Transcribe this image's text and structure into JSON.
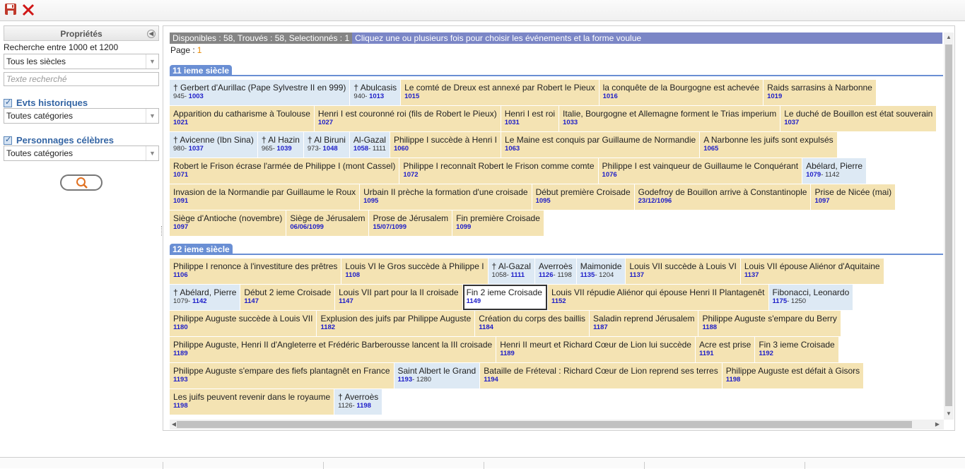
{
  "toolbar": {
    "save": "save-icon",
    "close": "close-icon"
  },
  "sidebar": {
    "title": "Propriétés",
    "range_label": "Recherche entre 1000 et 1200",
    "siecle_select": "Tous les siècles",
    "search_placeholder": "Texte recherché",
    "evts_label": "Evts historiques",
    "evts_select": "Toutes catégories",
    "pers_label": "Personnages célèbres",
    "pers_select": "Toutes catégories"
  },
  "status": {
    "counts": "Disponibles : 58, Trouvés : 58, Selectionnés : 1",
    "hint": "Cliquez une ou plusieurs fois pour choisir les événements et la forme voulue"
  },
  "page": {
    "label": "Page :",
    "number": "1"
  },
  "sections": [
    {
      "title": "11 ieme siècle",
      "rows": [
        [
          {
            "kind": "pe",
            "t": "† Gerbert d'Aurillac (Pape Sylvestre II en 999)",
            "y0": "945- ",
            "y": "1003"
          },
          {
            "kind": "pe",
            "t": "† Abulcasis",
            "y0": "940- ",
            "y": "1013"
          },
          {
            "kind": "ev",
            "t": "Le comté de Dreux est annexé par Robert le Pieux",
            "y": "1015"
          },
          {
            "kind": "ev",
            "t": "la conquête de la Bourgogne est achevée",
            "y": "1016"
          },
          {
            "kind": "ev",
            "t": "Raids sarrasins à Narbonne",
            "y": "1019"
          }
        ],
        [
          {
            "kind": "ev",
            "t": "Apparition du catharisme à Toulouse",
            "y": "1021"
          },
          {
            "kind": "ev",
            "t": "Henri I est couronné roi (fils de Robert le Pieux)",
            "y": "1027"
          },
          {
            "kind": "ev",
            "t": "Henri I est roi",
            "y": "1031"
          },
          {
            "kind": "ev",
            "t": "Italie, Bourgogne et Allemagne forment le Trias imperium",
            "y": "1033"
          },
          {
            "kind": "ev",
            "t": "Le duché de Bouillon est état souverain",
            "y": "1037"
          }
        ],
        [
          {
            "kind": "pe",
            "t": "† Avicenne (Ibn Sina)",
            "y0": "980- ",
            "y": "1037"
          },
          {
            "kind": "pe",
            "t": "† Al Hazin",
            "y0": "965- ",
            "y": "1039"
          },
          {
            "kind": "pe",
            "t": "† Al Biruni",
            "y0": "973- ",
            "y": "1048"
          },
          {
            "kind": "pe",
            "t": "Al-Gazal",
            "y": "1058",
            "y1": "- 1111"
          },
          {
            "kind": "ev",
            "t": "Philippe I succède à Henri I",
            "y": "1060"
          },
          {
            "kind": "ev",
            "t": "Le Maine est conquis par Guillaume de Normandie",
            "y": "1063"
          },
          {
            "kind": "ev",
            "t": "A Narbonne les juifs sont expulsés",
            "y": "1065"
          }
        ],
        [
          {
            "kind": "ev",
            "t": "Robert le Frison écrase l'armée de Philippe I (mont Cassel)",
            "y": "1071"
          },
          {
            "kind": "ev",
            "t": "Philippe I reconnaît Robert le Frison comme comte",
            "y": "1072"
          },
          {
            "kind": "ev",
            "t": "Philippe I est vainqueur de Guillaume le Conquérant",
            "y": "1076"
          },
          {
            "kind": "pe",
            "t": "Abélard, Pierre",
            "y": "1079",
            "y1": "- 1142"
          }
        ],
        [
          {
            "kind": "ev",
            "t": "Invasion de la Normandie par Guillaume le Roux",
            "y": "1091"
          },
          {
            "kind": "ev",
            "t": "Urbain II prèche la formation d'une croisade",
            "y": "1095"
          },
          {
            "kind": "ev",
            "t": "Début première Croisade",
            "y": "1095"
          },
          {
            "kind": "ev",
            "t": "Godefroy de Bouillon arrive à Constantinople",
            "y": "23/12/1096"
          },
          {
            "kind": "ev",
            "t": "Prise de Nicée (mai)",
            "y": "1097"
          }
        ],
        [
          {
            "kind": "ev",
            "t": "Siège d'Antioche (novembre)",
            "y": "1097"
          },
          {
            "kind": "ev",
            "t": "Siège de Jérusalem",
            "y": "06/06/1099"
          },
          {
            "kind": "ev",
            "t": "Prose de Jérusalem",
            "y": "15/07/1099"
          },
          {
            "kind": "ev",
            "t": "Fin première Croisade",
            "y": "1099"
          }
        ]
      ]
    },
    {
      "title": "12 ieme siècle",
      "rows": [
        [
          {
            "kind": "ev",
            "t": "Philippe I renonce à l'investiture des prêtres",
            "y": "1106"
          },
          {
            "kind": "ev",
            "t": "Louis VI le Gros succède à Philippe I",
            "y": "1108"
          },
          {
            "kind": "pe",
            "t": "† Al-Gazal",
            "y0": "1058- ",
            "y": "1111"
          },
          {
            "kind": "pe",
            "t": "Averroès",
            "y": "1126",
            "y1": "- 1198"
          },
          {
            "kind": "pe",
            "t": "Maimonide",
            "y": "1135",
            "y1": "- 1204"
          },
          {
            "kind": "ev",
            "t": "Louis VII succède à Louis VI",
            "y": "1137"
          },
          {
            "kind": "ev",
            "t": "Louis VII épouse Aliénor d'Aquitaine",
            "y": "1137"
          }
        ],
        [
          {
            "kind": "pe",
            "t": "† Abélard, Pierre",
            "y0": "1079- ",
            "y": "1142"
          },
          {
            "kind": "ev",
            "t": "Début 2 ieme Croisade",
            "y": "1147"
          },
          {
            "kind": "ev",
            "t": "Louis VII part pour la II croisade",
            "y": "1147"
          },
          {
            "kind": "sel",
            "t": "Fin 2 ieme Croisade",
            "y": "1149"
          },
          {
            "kind": "ev",
            "t": "Louis VII répudie Aliénor qui épouse Henri II Plantagenêt",
            "y": "1152"
          },
          {
            "kind": "pe",
            "t": "Fibonacci, Leonardo",
            "y": "1175",
            "y1": "- 1250"
          }
        ],
        [
          {
            "kind": "ev",
            "t": "Philippe Auguste succède à Louis VII",
            "y": "1180"
          },
          {
            "kind": "ev",
            "t": "Explusion des juifs par Philippe Auguste",
            "y": "1182"
          },
          {
            "kind": "ev",
            "t": "Création du corps des baillis",
            "y": "1184"
          },
          {
            "kind": "ev",
            "t": "Saladin reprend Jérusalem",
            "y": "1187"
          },
          {
            "kind": "ev",
            "t": "Philippe Auguste s'empare du Berry",
            "y": "1188"
          }
        ],
        [
          {
            "kind": "ev",
            "t": "Philippe Auguste, Henri II d'Angleterre et Frédéric Barberousse lancent la III croisade",
            "y": "1189"
          },
          {
            "kind": "ev",
            "t": "Henri II meurt et Richard Cœur de Lion lui succède",
            "y": "1189"
          },
          {
            "kind": "ev",
            "t": "Acre est prise",
            "y": "1191"
          },
          {
            "kind": "ev",
            "t": "Fin 3 ieme Croisade",
            "y": "1192"
          }
        ],
        [
          {
            "kind": "ev",
            "t": "Philippe Auguste s'empare des fiefs plantagnêt en France",
            "y": "1193"
          },
          {
            "kind": "pe",
            "t": "Saint Albert le Grand",
            "y": "1193",
            "y1": "- 1280"
          },
          {
            "kind": "ev",
            "t": "Bataille de Fréteval : Richard Cœur de Lion reprend ses terres",
            "y": "1194"
          },
          {
            "kind": "ev",
            "t": "Philippe Auguste est défait à Gisors",
            "y": "1198"
          }
        ],
        [
          {
            "kind": "ev",
            "t": "Les juifs peuvent revenir dans le royaume",
            "y": "1198"
          },
          {
            "kind": "pe",
            "t": "† Averroès",
            "y0": "1126- ",
            "y": "1198"
          }
        ]
      ]
    }
  ]
}
